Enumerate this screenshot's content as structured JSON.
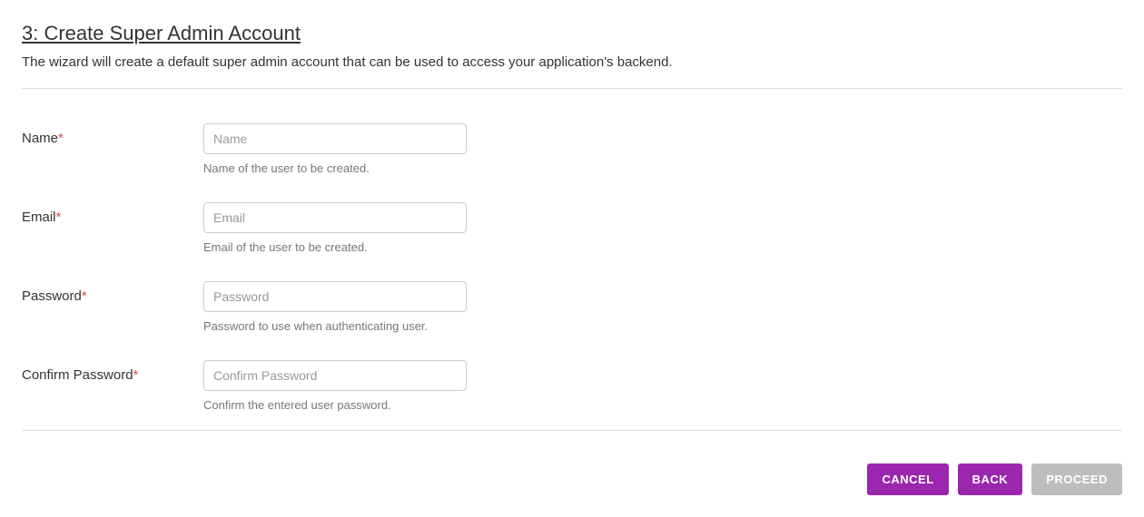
{
  "header": {
    "title": "3: Create Super Admin Account",
    "description": "The wizard will create a default super admin account that can be used to access your application's backend."
  },
  "form": {
    "name": {
      "label": "Name",
      "required_marker": "*",
      "placeholder": "Name",
      "value": "",
      "help": "Name of the user to be created."
    },
    "email": {
      "label": "Email",
      "required_marker": "*",
      "placeholder": "Email",
      "value": "",
      "help": "Email of the user to be created."
    },
    "password": {
      "label": "Password",
      "required_marker": "*",
      "placeholder": "Password",
      "value": "",
      "help": "Password to use when authenticating user."
    },
    "confirm_password": {
      "label": "Confirm Password",
      "required_marker": "*",
      "placeholder": "Confirm Password",
      "value": "",
      "help": "Confirm the entered user password."
    }
  },
  "footer": {
    "cancel_label": "CANCEL",
    "back_label": "BACK",
    "proceed_label": "PROCEED"
  }
}
